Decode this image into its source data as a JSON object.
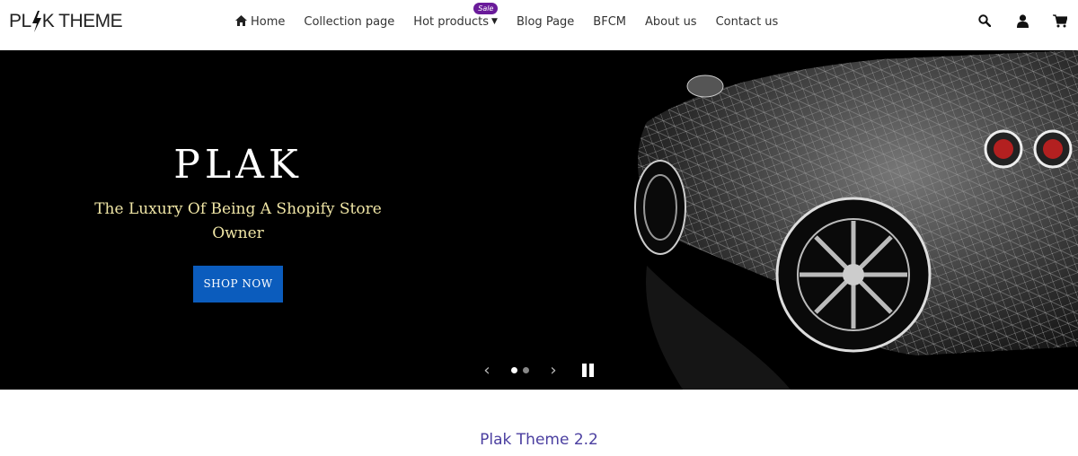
{
  "header": {
    "logo_text_a": "PL",
    "logo_text_b": "K THEME",
    "nav": [
      {
        "label": "Home",
        "icon": "home-icon"
      },
      {
        "label": "Collection page"
      },
      {
        "label": "Hot products",
        "badge": "Sale",
        "has_dropdown": true
      },
      {
        "label": "Blog Page"
      },
      {
        "label": "BFCM"
      },
      {
        "label": "About us"
      },
      {
        "label": "Contact us"
      }
    ],
    "icons": [
      "search-icon",
      "account-icon",
      "cart-icon"
    ]
  },
  "hero": {
    "title": "PLAK",
    "subtitle": "The Luxury Of Being A Shopify Store Owner",
    "button_label": "SHOP NOW",
    "slides_count": 2,
    "active_slide": 1,
    "prev_glyph": "‹",
    "next_glyph": "›"
  },
  "section": {
    "title": "Plak Theme 2.2"
  },
  "colors": {
    "accent_button": "#0b5cbd",
    "badge": "#6a1b9a",
    "subtitle": "#f0e6a6",
    "section_title": "#4b3fa0"
  }
}
